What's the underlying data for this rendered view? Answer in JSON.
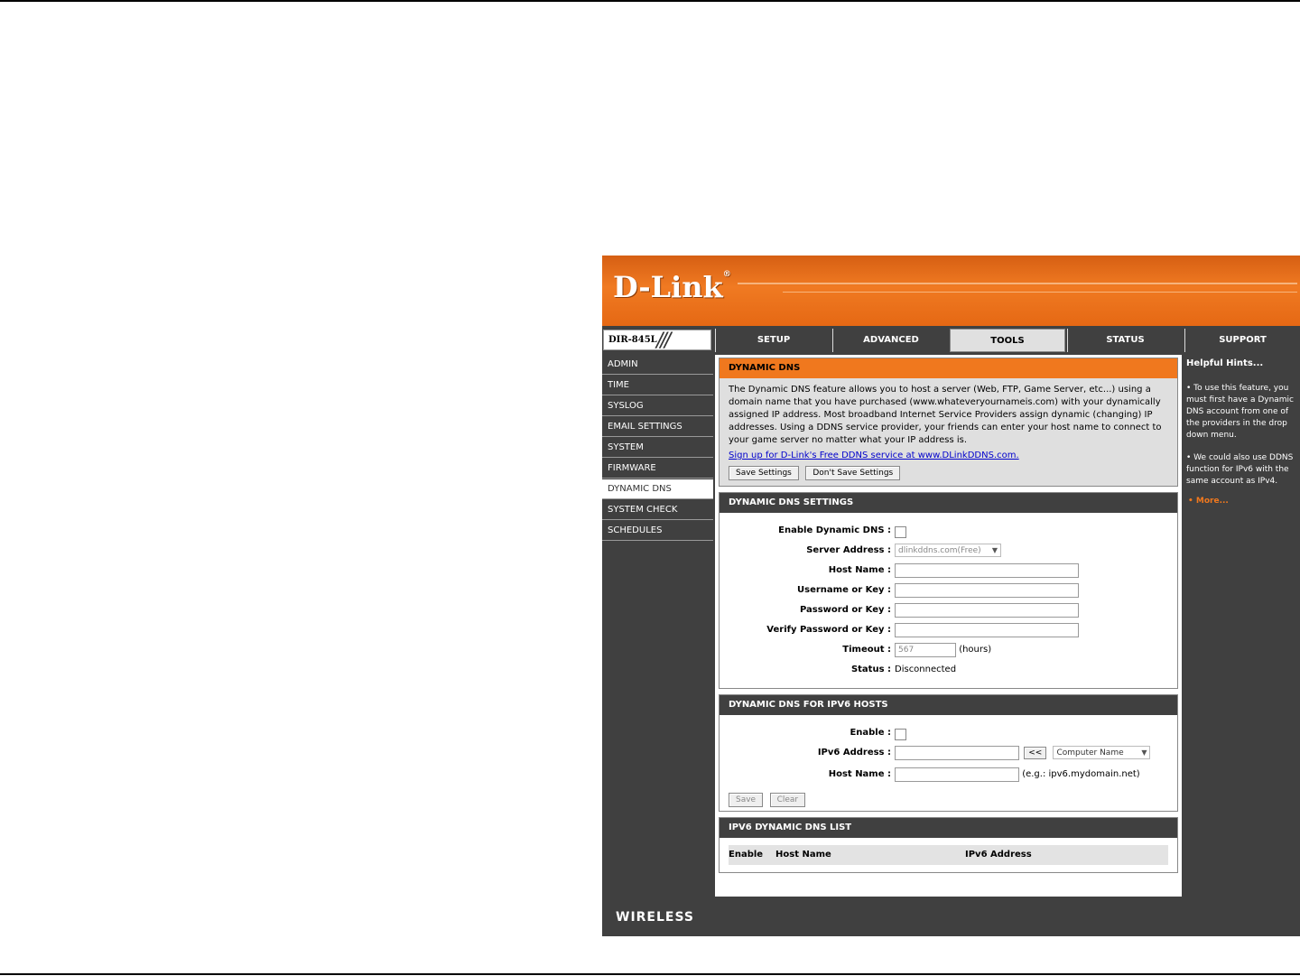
{
  "brand": {
    "logo": "D-Link",
    "trademark": "®",
    "model": "DIR-845L",
    "footer": "WIRELESS"
  },
  "nav": {
    "tabs": [
      "SETUP",
      "ADVANCED",
      "TOOLS",
      "STATUS",
      "SUPPORT"
    ],
    "active": "TOOLS"
  },
  "sidebar": {
    "items": [
      "ADMIN",
      "TIME",
      "SYSLOG",
      "EMAIL SETTINGS",
      "SYSTEM",
      "FIRMWARE",
      "DYNAMIC DNS",
      "SYSTEM CHECK",
      "SCHEDULES"
    ],
    "active": "DYNAMIC DNS"
  },
  "intro": {
    "title": "DYNAMIC DNS",
    "text": "The Dynamic DNS feature allows you to host a server (Web, FTP, Game Server, etc...) using a domain name that you have purchased (www.whateveryournameis.com) with your dynamically assigned IP address. Most broadband Internet Service Providers assign dynamic (changing) IP addresses. Using a DDNS service provider, your friends can enter your host name to connect to your game server no matter what your IP address is.",
    "link": "Sign up for D-Link's Free DDNS service at www.DLinkDDNS.com.",
    "save_button": "Save Settings",
    "dont_save_button": "Don't Save Settings"
  },
  "ddns_settings": {
    "title": "DYNAMIC DNS SETTINGS",
    "enable_label": "Enable Dynamic DNS :",
    "server_label": "Server Address :",
    "server_value": "dlinkddns.com(Free)",
    "host_label": "Host Name :",
    "username_label": "Username or Key :",
    "password_label": "Password or Key :",
    "verify_label": "Verify Password or Key :",
    "timeout_label": "Timeout :",
    "timeout_value": "567",
    "timeout_unit": "(hours)",
    "status_label": "Status :",
    "status_value": "Disconnected"
  },
  "ipv6_hosts": {
    "title": "DYNAMIC DNS FOR IPV6 HOSTS",
    "enable_label": "Enable :",
    "ipv6_label": "IPv6 Address :",
    "copy_button": "<<",
    "computer_select": "Computer Name",
    "host_label": "Host Name :",
    "host_hint": "(e.g.: ipv6.mydomain.net)",
    "save_button": "Save",
    "clear_button": "Clear"
  },
  "ipv6_list": {
    "title": "IPV6 DYNAMIC DNS LIST",
    "columns": [
      "Enable",
      "Host Name",
      "IPv6 Address"
    ]
  },
  "hints": {
    "title": "Helpful Hints...",
    "items": [
      "To use this feature, you must first have a Dynamic DNS account from one of the providers in the drop down menu.",
      "We could also use DDNS function for IPv6 with the same account as IPv4."
    ],
    "more": "More..."
  },
  "colors": {
    "orange": "#f0781e",
    "dark": "#404040",
    "panel": "#dfdfdf",
    "link": "#0000cc"
  }
}
